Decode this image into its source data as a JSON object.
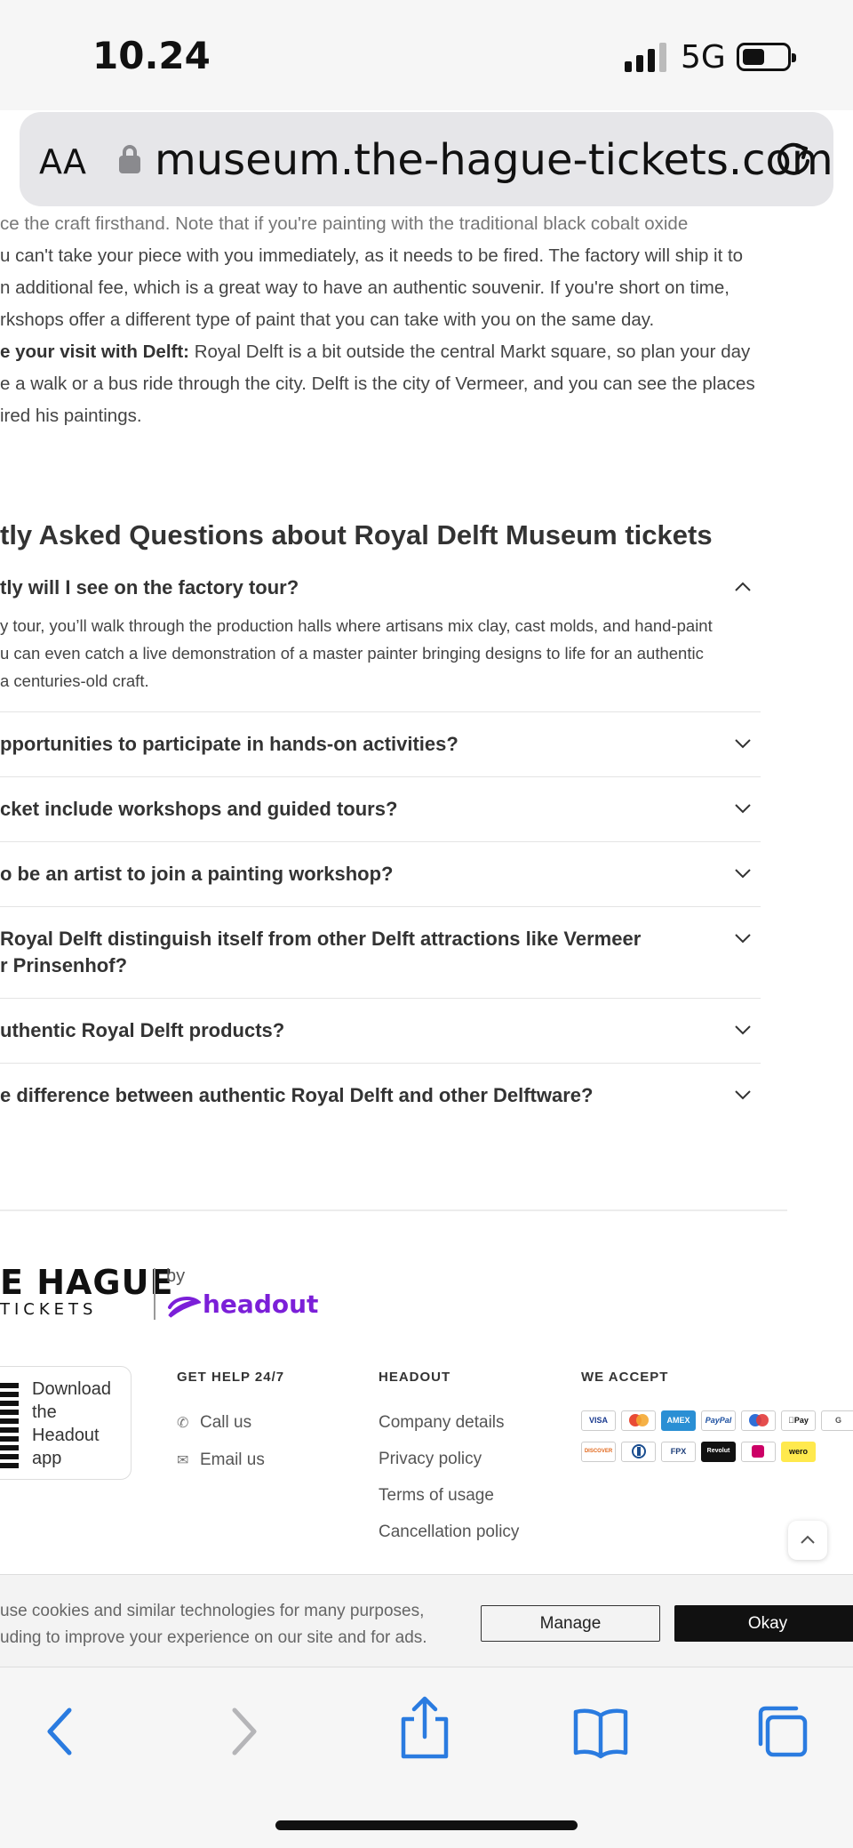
{
  "status_bar": {
    "time": "10.24",
    "network": "5G"
  },
  "browser": {
    "text_size_label": "AA",
    "url": "museum.the-hague-tickets.com"
  },
  "article": {
    "lines": [
      "ce the craft firsthand. Note that if you're painting with the traditional black cobalt oxide",
      "u can't take your piece with you immediately, as it needs to be fired. The factory will ship it to",
      "n additional fee, which is a great way to have an authentic souvenir. If you're short on time,",
      "rkshops offer a different type of paint that you can take with you on the same day."
    ],
    "visit_bold": "e your visit with Delft:",
    "visit_rest": " Royal Delft is a bit outside the central Markt square, so plan your day",
    "visit_lines": [
      "e a walk or a bus ride through the city. Delft is the city of Vermeer, and you can see the places",
      "ired his paintings."
    ]
  },
  "faq": {
    "title": "tly Asked Questions about Royal Delft Museum tickets",
    "items": [
      {
        "question": "tly will I see on the factory tour?",
        "answer_lines": [
          "y tour, you’ll walk through the production halls where artisans mix clay, cast molds, and hand-paint",
          "u can even catch a live demonstration of a master painter bringing designs to life for an authentic",
          "a centuries-old craft."
        ]
      },
      {
        "question": "pportunities to participate in hands-on activities?"
      },
      {
        "question": "cket include workshops and guided tours?"
      },
      {
        "question": "o be an artist to join a painting workshop?"
      },
      {
        "question": "Royal Delft distinguish itself from other Delft attractions like Vermeer",
        "question_line2": "r Prinsenhof?"
      },
      {
        "question": "uthentic Royal Delft products?"
      },
      {
        "question": "e difference between authentic Royal Delft and other Delftware?"
      }
    ]
  },
  "footer": {
    "brand_main": "E HAGUE",
    "brand_sub": "TICKETS",
    "by": "by",
    "partner": "headout",
    "download": "Download the Headout app",
    "help": {
      "heading": "GET HELP 24/7",
      "call": "Call us",
      "email": "Email us"
    },
    "headout": {
      "heading": "HEADOUT",
      "links": [
        "Company details",
        "Privacy policy",
        "Terms of usage",
        "Cancellation policy"
      ]
    },
    "payments": {
      "heading": "WE ACCEPT",
      "cards": [
        "VISA",
        "",
        "AMEX",
        "PayPal",
        "",
        "Pay",
        "G",
        "DISCOVER",
        "",
        "FPX",
        "Revolut",
        "",
        "wero"
      ]
    }
  },
  "cookie": {
    "lines": [
      "use cookies and similar technologies for many purposes,",
      "uding to improve your experience on our site and for ads."
    ],
    "manage": "Manage",
    "okay": "Okay"
  },
  "colors": {
    "accent": "#7b1fd8",
    "ios_blue": "#2a7be0"
  }
}
